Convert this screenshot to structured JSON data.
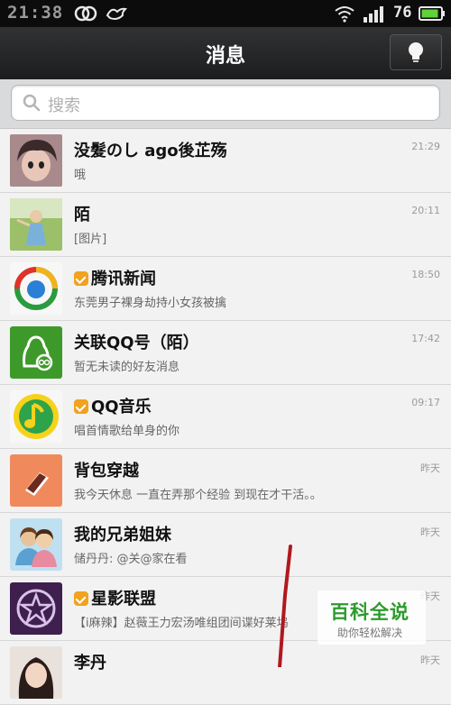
{
  "status_bar": {
    "time": "21:38",
    "battery": "76"
  },
  "header": {
    "title": "消息"
  },
  "search": {
    "placeholder": "搜索"
  },
  "conversations": [
    {
      "name": "没髮のし ago後芷殇",
      "preview": "哦",
      "time": "21:29",
      "verified": false
    },
    {
      "name": "陌",
      "preview": "[图片]",
      "time": "20:11",
      "verified": false
    },
    {
      "name": "腾讯新闻",
      "preview": "东莞男子裸身劫持小女孩被擒",
      "time": "18:50",
      "verified": true
    },
    {
      "name": "关联QQ号（陌）",
      "preview": "暂无未读的好友消息",
      "time": "17:42",
      "verified": false
    },
    {
      "name": "QQ音乐",
      "preview": "唱首情歌给单身的你",
      "time": "09:17",
      "verified": true
    },
    {
      "name": "背包穿越",
      "preview": "我今天休息 一直在弄那个经验 到现在才干活。。",
      "time": "昨天",
      "verified": false
    },
    {
      "name": "我的兄弟姐妹",
      "preview": "储丹丹: @关@家在看",
      "time": "昨天",
      "verified": false
    },
    {
      "name": "星影联盟",
      "preview": "【i麻辣】赵薇王力宏汤唯组团间谍好莱坞",
      "time": "昨天",
      "verified": true
    },
    {
      "name": "李丹",
      "preview": "",
      "time": "昨天",
      "verified": false
    }
  ],
  "watermark": {
    "title": "百科全说",
    "subtitle": "助你轻松解决"
  },
  "colors": {
    "verified_badge": "#f0a31f",
    "header_bg": "#1c1d1f",
    "watermark_green": "#2c9b2c",
    "annotation_red": "#b0191e"
  }
}
